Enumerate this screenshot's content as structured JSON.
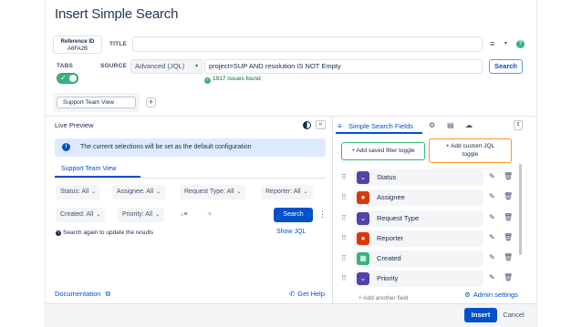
{
  "dialog": {
    "title": "Insert Simple Search"
  },
  "reference": {
    "label": "Reference ID",
    "value": "A6FA2B"
  },
  "title_field": {
    "label": "TITLE",
    "value": ""
  },
  "tabs_toggle": {
    "label": "TABS",
    "on": true
  },
  "source": {
    "label": "SOURCE",
    "selected": "Advanced (JQL)",
    "jql": "project=SUP AND resolution IS NOT Empty",
    "search_label": "Search",
    "issues_found": "1917 issues found"
  },
  "tab_chip": {
    "label": "Support Team View"
  },
  "live_preview": {
    "title": "Live Preview",
    "info": "The current selections will be set as the default configuration",
    "tab_label": "Support Team View",
    "filters": [
      {
        "label": "Status: All"
      },
      {
        "label": "Assignee: All"
      },
      {
        "label": "Request Type: All"
      },
      {
        "label": "Reporter: All"
      },
      {
        "label": "Created: All"
      },
      {
        "label": "Priority: All"
      }
    ],
    "sort_label": "↓≡",
    "search_button": "Search",
    "search_again": "Search again to update the results",
    "show_jql": "Show JQL"
  },
  "right_panel": {
    "title": "Simple Search Fields",
    "add_saved": "+ Add saved filter toggle",
    "add_custom_line1": "+ Add custom JQL",
    "add_custom_line2": "toggle",
    "fields": [
      {
        "name": "Status",
        "icon": "status-icon",
        "color": "#5243aa"
      },
      {
        "name": "Assignee",
        "icon": "person-icon",
        "color": "#de350b"
      },
      {
        "name": "Request Type",
        "icon": "request-type-icon",
        "color": "#5243aa"
      },
      {
        "name": "Reporter",
        "icon": "person-icon",
        "color": "#de350b"
      },
      {
        "name": "Created",
        "icon": "calendar-icon",
        "color": "#36b37e"
      },
      {
        "name": "Priority",
        "icon": "priority-icon",
        "color": "#5243aa"
      }
    ],
    "add_another": "+ Add another field",
    "admin_settings": "Admin settings"
  },
  "links": {
    "documentation": "Documentation",
    "get_help": "Get Help"
  },
  "footer": {
    "insert": "Insert",
    "cancel": "Cancel"
  },
  "colors": {
    "primary": "#0052cc",
    "success": "#36b37e",
    "warning": "#ff991f"
  }
}
